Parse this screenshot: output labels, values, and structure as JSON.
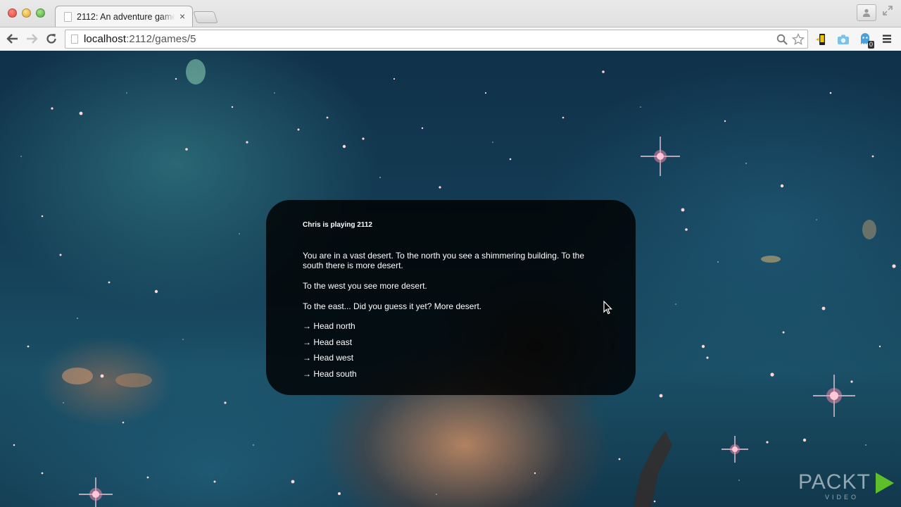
{
  "browser": {
    "tab_title": "2112: An adventure game",
    "tab_close": "×",
    "url_host": "localhost",
    "url_path": ":2112/games/5"
  },
  "game": {
    "player_line": "Chris is playing 2112",
    "paragraphs": [
      "You are in a vast desert. To the north you see a shimmering building. To the south there is more desert.",
      "To the west you see more desert.",
      "To the east... Did you guess it yet? More desert."
    ],
    "actions": [
      "→ Head north",
      "→ Head east",
      "→ Head west",
      "→ Head south"
    ]
  },
  "extensions": {
    "badge_count": "0"
  },
  "watermark": {
    "brand": "PACKT",
    "sub": "VIDEO"
  },
  "icons": {
    "back": "arrow-left-icon",
    "forward": "arrow-right-icon",
    "reload": "reload-icon",
    "search": "search-icon",
    "star": "star-icon",
    "menu": "hamburger-icon",
    "profile": "person-icon",
    "fullscreen": "fullscreen-icon",
    "cursor": "mouse-pointer-icon"
  }
}
